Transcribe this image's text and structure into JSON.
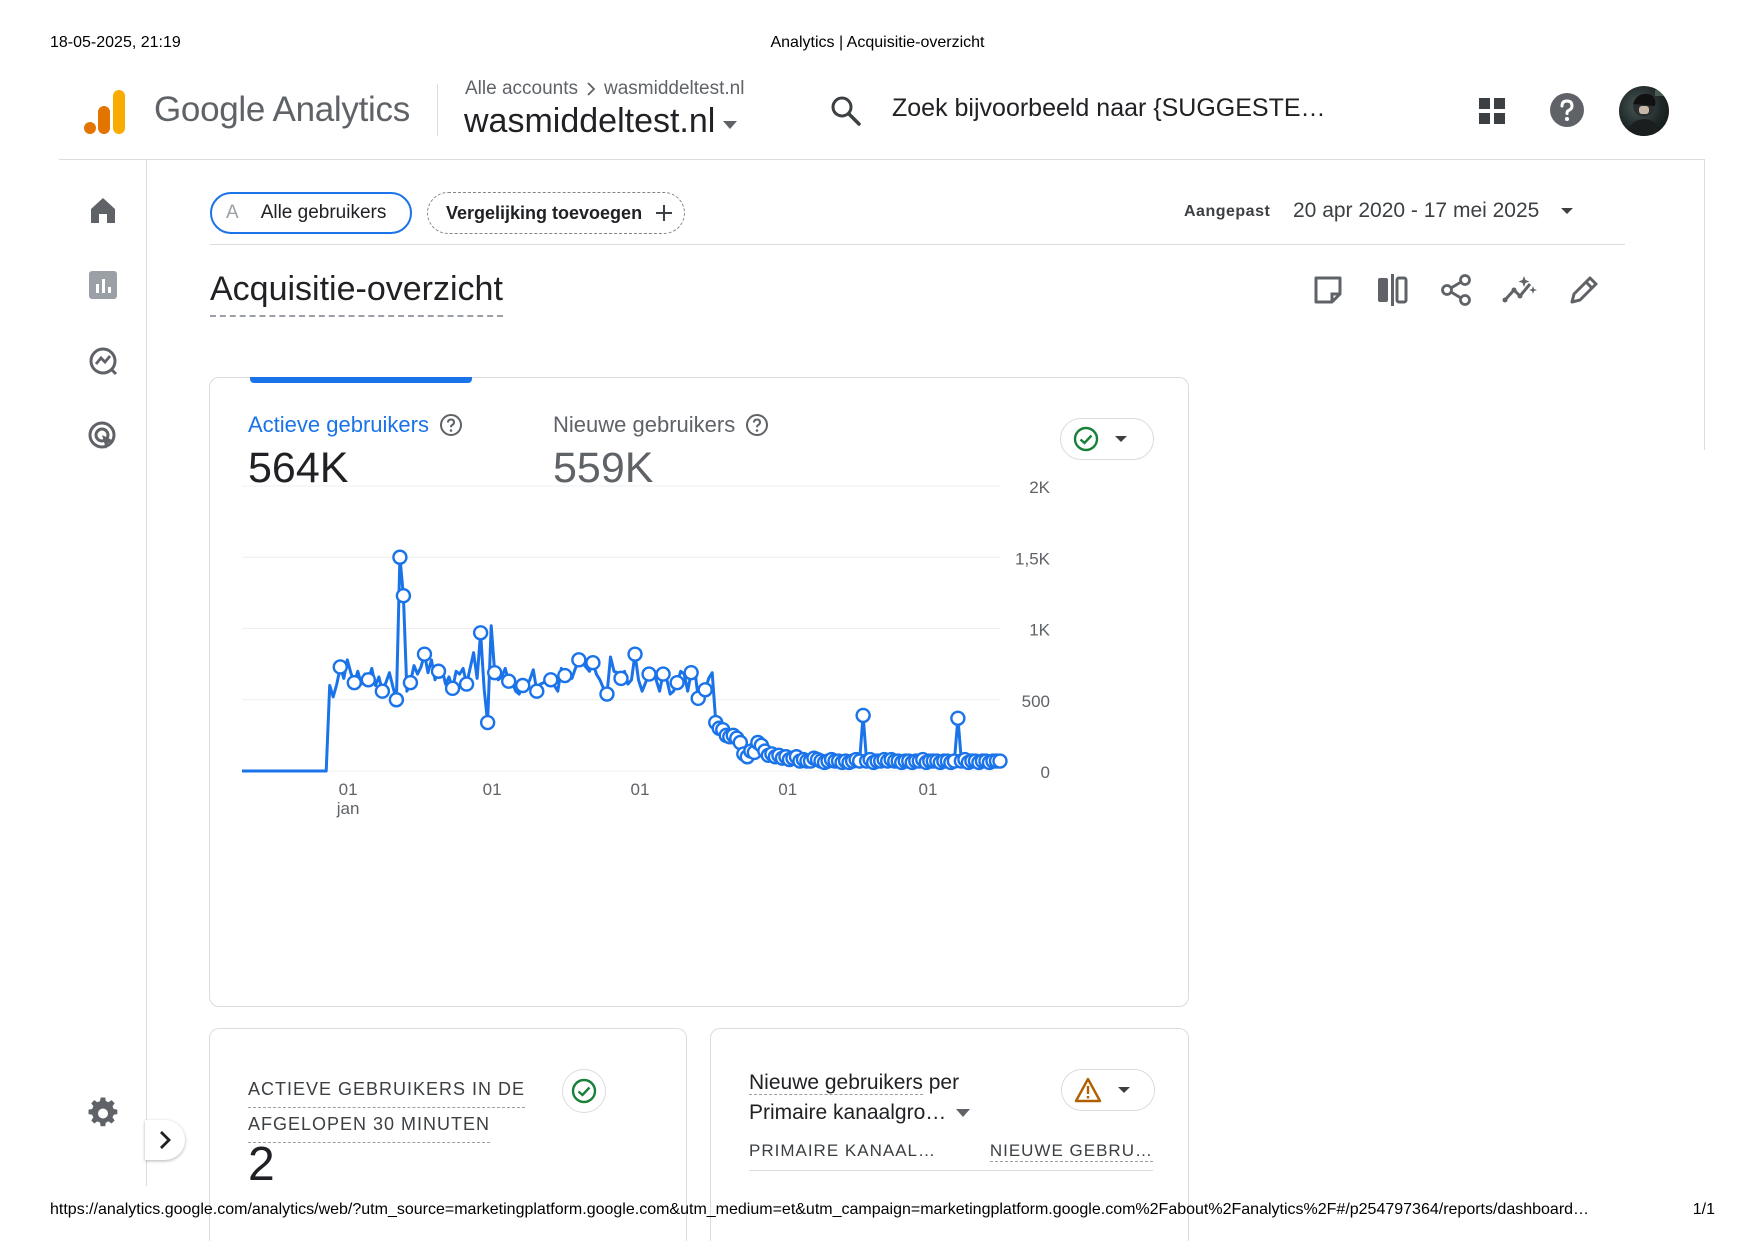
{
  "print": {
    "datetime": "18-05-2025, 21:19",
    "title": "Analytics | Acquisitie-overzicht",
    "url": "https://analytics.google.com/analytics/web/?utm_source=marketingplatform.google.com&utm_medium=et&utm_campaign=marketingplatform.google.com%2Fabout%2Fanalytics%2F#/p254797364/reports/dashboard…",
    "page": "1/1"
  },
  "header": {
    "app_name": "Google Analytics",
    "breadcrumb_accounts": "Alle accounts",
    "breadcrumb_property": "wasmiddeltest.nl",
    "property": "wasmiddeltest.nl",
    "search_placeholder": "Zoek bijvoorbeeld naar {SUGGESTE…"
  },
  "filters": {
    "segment_letter": "A",
    "segment": "Alle gebruikers",
    "add_comparison": "Vergelijking toevoegen",
    "date_label": "Aangepast",
    "date_range": "20 apr 2020 - 17 mei 2025"
  },
  "page": {
    "title": "Acquisitie-overzicht"
  },
  "main_card": {
    "metric_active_label": "Actieve gebruikers",
    "metric_active_value": "564K",
    "metric_new_label": "Nieuwe gebruikers",
    "metric_new_value": "559K"
  },
  "chart_data": {
    "type": "line",
    "series": [
      {
        "values": [
          0,
          0,
          0,
          0,
          0,
          0,
          0,
          0,
          0,
          0,
          0,
          0,
          0,
          0,
          0,
          0,
          0,
          0,
          0,
          0,
          0,
          0,
          0,
          0,
          0,
          600,
          520,
          610,
          730,
          650,
          780,
          690,
          620,
          700,
          610,
          680,
          640,
          720,
          600,
          660,
          560,
          620,
          690,
          590,
          500,
          1500,
          1230,
          560,
          620,
          740,
          680,
          730,
          820,
          690,
          780,
          640,
          700,
          720,
          610,
          660,
          580,
          700,
          680,
          720,
          610,
          720,
          830,
          650,
          970,
          580,
          340,
          1020,
          690,
          640,
          660,
          720,
          630,
          620,
          560,
          540,
          600,
          590,
          640,
          710,
          560,
          610,
          620,
          660,
          640,
          600,
          560,
          720,
          670,
          690,
          650,
          720,
          780,
          760,
          730,
          700,
          760,
          680,
          640,
          580,
          540,
          800,
          700,
          690,
          650,
          700,
          610,
          640,
          820,
          640,
          560,
          620,
          680,
          710,
          640,
          560,
          680,
          650,
          540,
          560,
          620,
          700,
          680,
          560,
          690,
          720,
          510,
          560,
          570,
          650,
          690,
          340,
          300,
          290,
          250,
          240,
          250,
          230,
          200,
          120,
          100,
          140,
          130,
          200,
          180,
          140,
          110,
          120,
          100,
          110,
          90,
          100,
          80,
          90,
          100,
          70,
          80,
          70,
          70,
          90,
          80,
          70,
          60,
          70,
          80,
          70,
          70,
          60,
          70,
          60,
          70,
          80,
          70,
          390,
          70,
          80,
          60,
          70,
          70,
          80,
          70,
          80,
          70,
          70,
          60,
          70,
          70,
          60,
          70,
          70,
          80,
          60,
          70,
          70,
          70,
          60,
          70,
          70,
          60,
          70,
          370,
          70,
          80,
          60,
          70,
          70,
          60,
          70,
          70,
          60,
          70,
          70,
          70
        ]
      }
    ],
    "x_tick_labels": [
      "01\njan",
      "01",
      "01",
      "01",
      "01"
    ],
    "x_tick_positions": [
      0.14,
      0.33,
      0.525,
      0.72,
      0.905
    ],
    "y_ticks": [
      0,
      500,
      1000,
      1500,
      2000
    ],
    "y_tick_labels": [
      "0",
      "500",
      "1K",
      "1,5K",
      "2K"
    ],
    "ylim": [
      0,
      2000
    ],
    "grid": true,
    "color": "#1a73e8"
  },
  "realtime_card": {
    "title_line1": "ACTIEVE GEBRUIKERS IN DE",
    "title_line2": "AFGELOPEN 30 MINUTEN",
    "value": "2"
  },
  "channel_card": {
    "title_prefix": "Nieuwe gebruikers",
    "title_suffix": " per",
    "dimension": "Primaire kanaalgro…",
    "col1": "PRIMAIRE KANAAL…",
    "col2": "NIEUWE GEBRU…"
  },
  "colors": {
    "accent": "#1a73e8",
    "ok": "#188038",
    "warning": "#b06000"
  }
}
